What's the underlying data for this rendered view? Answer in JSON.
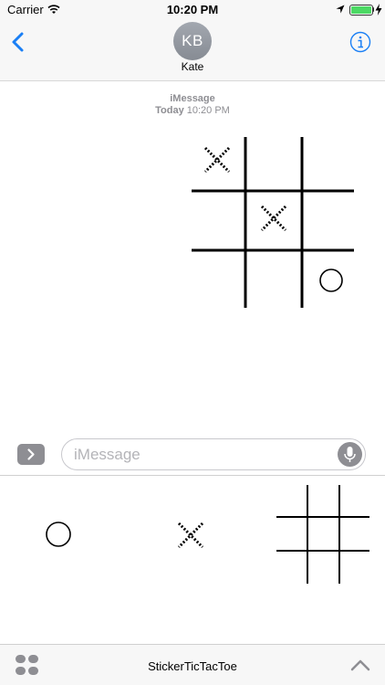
{
  "status_bar": {
    "carrier": "Carrier",
    "time": "10:20 PM",
    "battery_level": 1.0
  },
  "header": {
    "avatar_initials": "KB",
    "contact_name": "Kate"
  },
  "conversation": {
    "service_label": "iMessage",
    "timestamp_day": "Today",
    "timestamp_time": "10:20 PM",
    "board": {
      "cells": [
        "X",
        "",
        "",
        "",
        "X",
        "",
        "",
        "",
        "O"
      ]
    }
  },
  "compose": {
    "placeholder": "iMessage"
  },
  "drawer": {
    "stickers": [
      "O",
      "X",
      "grid"
    ]
  },
  "app_strip": {
    "title": "StickerTicTacToe"
  },
  "colors": {
    "accent": "#1a7ff5",
    "battery": "#4cd964",
    "secondary_text": "#8e8e93"
  },
  "icons": {
    "back": "chevron-left-icon",
    "info": "info-icon",
    "apps": "chevron-right-icon",
    "mic": "microphone-icon",
    "app_drawer": "app-drawer-icon",
    "expand": "chevron-up-icon"
  }
}
